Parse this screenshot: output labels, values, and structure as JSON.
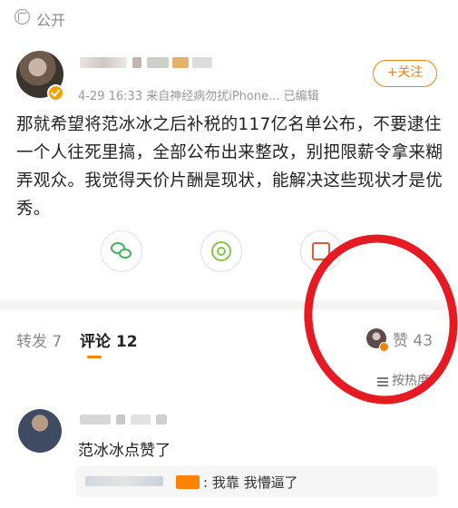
{
  "visibility": {
    "label": "公开"
  },
  "post": {
    "meta": "4-29 16:33 来自神经病勿扰iPhone... 已编辑",
    "follow_label": "+关注",
    "text": "那就希望将范冰冰之后补税的117亿名单公布，不要逮住一个人往死里搞，全部公布出来整改，别把限薪令拿来糊弄观众。我觉得天价片酬是现状，能解决这些现状才是优秀。"
  },
  "tabs": {
    "repost": "转发 7",
    "comments": "评论 12",
    "likes": "赞 43"
  },
  "sort_label": "按热度",
  "comment": {
    "text": "范冰冰点赞了",
    "reply": ": 我靠 我懵逼了"
  },
  "colors": {
    "accent": "#ff8200",
    "annotation": "#e61a23",
    "wechat": "#3db35a",
    "moments": "#86c545"
  }
}
